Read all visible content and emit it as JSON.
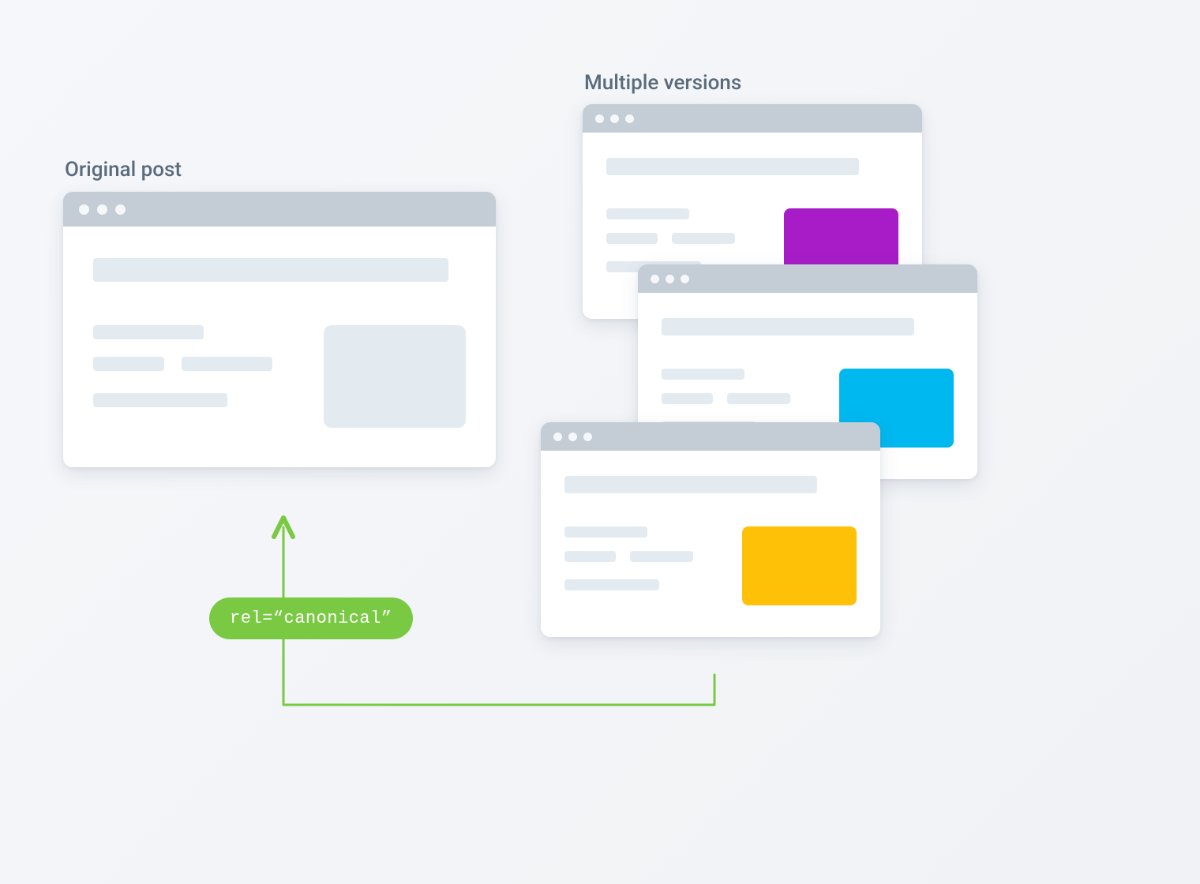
{
  "labels": {
    "original": "Original post",
    "versions": "Multiple versions"
  },
  "pill": {
    "text": "rel=“canonical”"
  },
  "colors": {
    "titlebar": "#c4cdd5",
    "placeholder": "#e3eaf0",
    "arrow": "#7ac943",
    "pill_bg": "#7ac943",
    "pill_text": "#ffffff",
    "label_text": "#5a6b7b",
    "accent_purple": "#a81cc7",
    "accent_cyan": "#00b8f0",
    "accent_yellow": "#ffc107"
  },
  "diagram": {
    "concept": "canonical-link-element",
    "original_count": 1,
    "version_count": 3
  }
}
